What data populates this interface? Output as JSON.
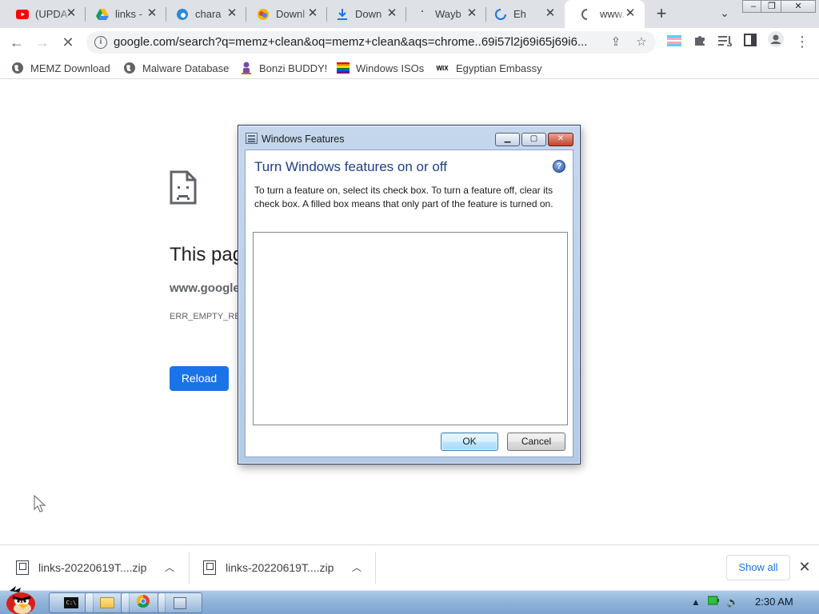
{
  "browser": {
    "tabs": [
      {
        "title": "(UPDA",
        "icon": "youtube-icon"
      },
      {
        "title": "links -",
        "icon": "google-drive-icon"
      },
      {
        "title": "chara",
        "icon": "edge-swirl-icon"
      },
      {
        "title": "Downl",
        "icon": "download-site-icon"
      },
      {
        "title": "Down",
        "icon": "download-arrow-icon"
      },
      {
        "title": "Wayb",
        "icon": "wayback-icon"
      },
      {
        "title": "Eh",
        "icon": "loading-spinner-icon"
      },
      {
        "title": "www.",
        "icon": "loading-spinner-icon",
        "active": true
      }
    ],
    "new_tab_label": "+",
    "url": "google.com/search?q=memz+clean&oq=memz+clean&aqs=chrome..69i57l2j69i65j69i6...",
    "bookmarks": [
      {
        "label": "MEMZ Download",
        "icon": "globe-icon"
      },
      {
        "label": "Malware Database",
        "icon": "globe-icon"
      },
      {
        "label": "Bonzi BUDDY!",
        "icon": "bonzi-icon"
      },
      {
        "label": "Windows ISOs",
        "icon": "rainbow-flag-icon"
      },
      {
        "label": "Egyptian Embassy",
        "icon": "wix-icon"
      }
    ],
    "wix_glyph": "WIX"
  },
  "error_page": {
    "title": "This pag",
    "host": "www.google",
    "code": "ERR_EMPTY_RES",
    "reload_label": "Reload"
  },
  "dialog": {
    "window_title": "Windows Features",
    "heading": "Turn Windows features on or off",
    "description": "To turn a feature on, select its check box. To turn a feature off, clear its check box. A filled box means that only part of the feature is turned on.",
    "help_glyph": "?",
    "ok_label": "OK",
    "cancel_label": "Cancel"
  },
  "downloads": {
    "items": [
      {
        "filename": "links-20220619T....zip"
      },
      {
        "filename": "links-20220619T....zip"
      }
    ],
    "show_all_label": "Show all"
  },
  "taskbar": {
    "clock": "2:30 AM",
    "cmd_glyph": "C:\\"
  }
}
